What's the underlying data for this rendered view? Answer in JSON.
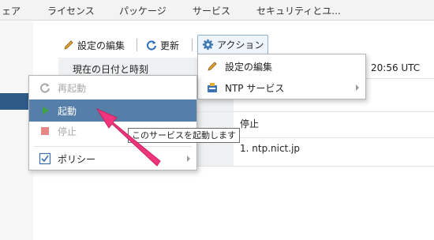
{
  "nav": {
    "tabs": [
      "ェア",
      "ライセンス",
      "パッケージ",
      "サービス",
      "セキュリティとユ..."
    ]
  },
  "toolbar": {
    "edit_label": "設定の編集",
    "refresh_label": "更新",
    "action_label": "アクション"
  },
  "properties": {
    "rows": [
      {
        "key": "現在の日付と時刻",
        "value": "20:56 UTC"
      },
      {
        "key": "",
        "value": ""
      },
      {
        "key": "",
        "value": "停止"
      },
      {
        "key": "",
        "value": "1. ntp.nict.jp"
      }
    ]
  },
  "action_menu": {
    "items": [
      {
        "label": "設定の編集",
        "icon": "pencil-icon"
      },
      {
        "label": "NTP サービス",
        "icon": "service-icon",
        "has_submenu": true
      }
    ]
  },
  "service_menu": {
    "items": [
      {
        "label": "再起動",
        "icon": "restart-icon",
        "disabled": true
      },
      {
        "label": "起動",
        "icon": "play-icon",
        "selected": true
      },
      {
        "label": "停止",
        "icon": "stop-icon",
        "disabled": true
      },
      {
        "label": "ポリシー",
        "icon": "policy-icon",
        "has_submenu": true
      }
    ]
  },
  "tooltip": {
    "text": "このサービスを起動します"
  },
  "colors": {
    "selected": "#557ea8",
    "accent_arrow": "#f0357d",
    "play": "#3fa33f",
    "stop": "#e98787"
  }
}
